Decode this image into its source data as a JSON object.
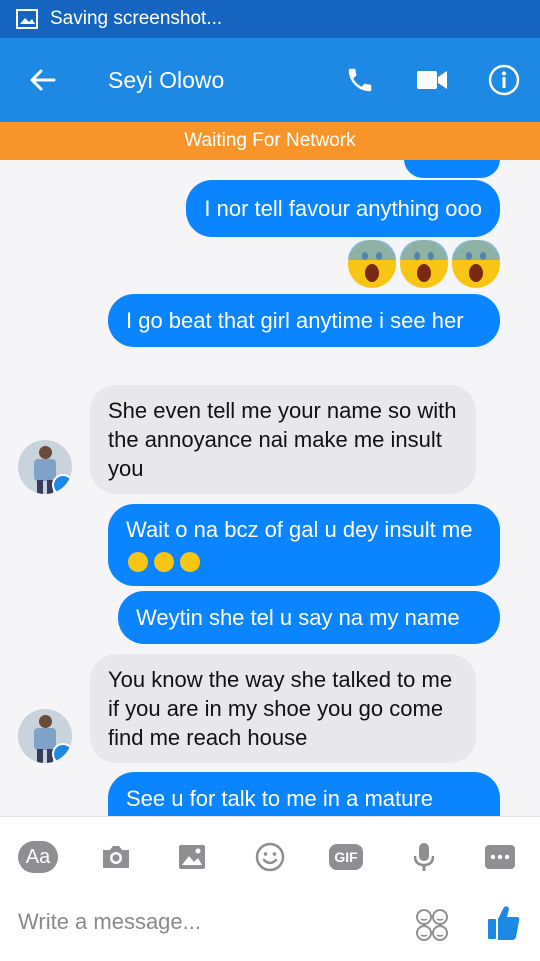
{
  "status_bar": {
    "text": "Saving screenshot..."
  },
  "app_bar": {
    "contact_name": "Seyi Olowo"
  },
  "network_banner": {
    "text": "Waiting For Network"
  },
  "messages": [
    {
      "direction": "out",
      "text": "I nor tell favour anything  ooo"
    },
    {
      "direction": "out",
      "emojis": [
        "screaming-face",
        "screaming-face",
        "screaming-face"
      ]
    },
    {
      "direction": "out",
      "text": "I go beat that girl anytime i see her"
    },
    {
      "direction": "in",
      "text": "She even tell me your name so with the annoyance nai make me insult you"
    },
    {
      "direction": "out",
      "text": "Wait o na bcz of gal u dey insult me"
    },
    {
      "direction": "out",
      "text": "Weytin she tel u say na my name"
    },
    {
      "direction": "in",
      "text": "You know the way she talked to me if you are in my shoe you go come find me reach house"
    },
    {
      "direction": "out",
      "text": "See u for talk to me in a mature"
    }
  ],
  "toolbar": {
    "aa_label": "Aa",
    "gif_label": "GIF",
    "compose_placeholder": "Write a message..."
  },
  "colors": {
    "status_bar": "#1565c0",
    "app_bar": "#1e88e5",
    "network_banner": "#f7952b",
    "outgoing_bubble": "#0a84ff",
    "incoming_bubble": "#e8e8ec"
  }
}
